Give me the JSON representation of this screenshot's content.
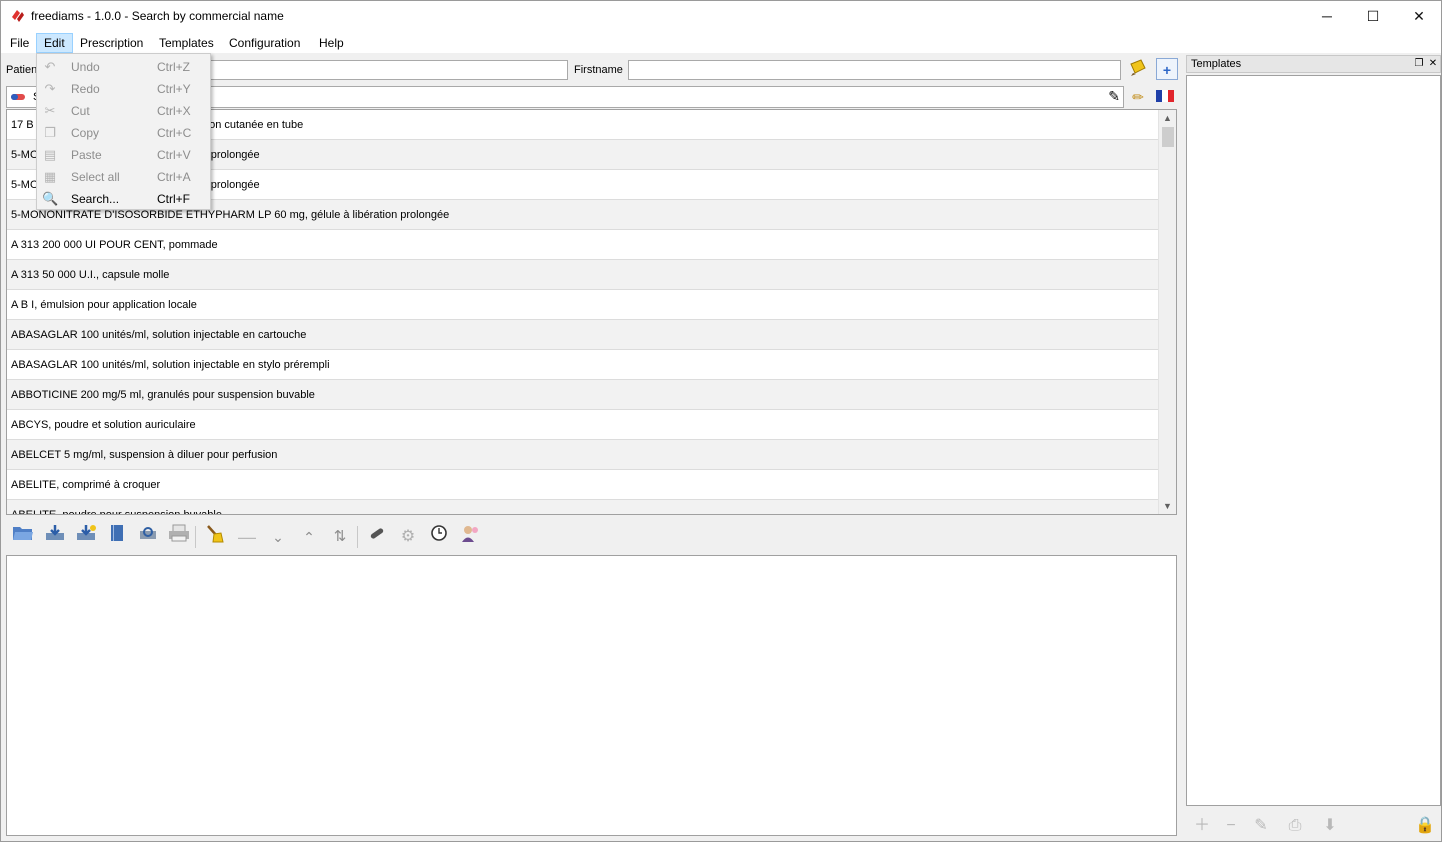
{
  "window": {
    "title": "freediams - 1.0.0 - Search by commercial name",
    "minimize": "─",
    "maximize": "☐",
    "close": "✕"
  },
  "menu": [
    "File",
    "Edit",
    "Prescription",
    "Templates",
    "Configuration",
    "Help"
  ],
  "patient": {
    "name_label": "Patien",
    "firstname_label": "Firstname",
    "search_prefix": "S"
  },
  "edit_menu": [
    {
      "label": "Undo",
      "shortcut": "Ctrl+Z",
      "icon": "undo-icon",
      "glyph": "↶"
    },
    {
      "label": "Redo",
      "shortcut": "Ctrl+Y",
      "icon": "redo-icon",
      "glyph": "↷"
    },
    {
      "label": "Cut",
      "shortcut": "Ctrl+X",
      "icon": "cut-icon",
      "glyph": "✂"
    },
    {
      "label": "Copy",
      "shortcut": "Ctrl+C",
      "icon": "copy-icon",
      "glyph": "❐"
    },
    {
      "label": "Paste",
      "shortcut": "Ctrl+V",
      "icon": "paste-icon",
      "glyph": "▤"
    },
    {
      "label": "Select all",
      "shortcut": "Ctrl+A",
      "icon": "select-all-icon",
      "glyph": "▦"
    },
    {
      "label": "Search...",
      "shortcut": "Ctrl+F",
      "icon": "search-icon",
      "glyph": "🔍"
    }
  ],
  "drugs": [
    "17 B E              5 POUR CENT, gel pour application cutanée en tube",
    "5-MO              ARM LP 20 mg, gélule à libération prolongée",
    "5-MO              ARM LP 40 mg, gélule à libération prolongée",
    "5-MONONITRATE D'ISOSORBIDE ETHYPHARM LP 60 mg, gélule à libération prolongée",
    "A 313 200 000 UI POUR CENT, pommade",
    "A 313 50 000 U.I., capsule molle",
    "A B I, émulsion pour application locale",
    "ABASAGLAR 100 unités/ml, solution injectable en cartouche",
    "ABASAGLAR 100 unités/ml, solution injectable en stylo prérempli",
    "ABBOTICINE 200 mg/5 ml, granulés pour suspension buvable",
    "ABCYS, poudre et solution auriculaire",
    "ABELCET 5 mg/ml, suspension à diluer pour perfusion",
    "ABELITE, comprimé à croquer",
    "ABELITE, poudre pour suspension buvable"
  ],
  "templates_dock": {
    "title": "Templates"
  }
}
